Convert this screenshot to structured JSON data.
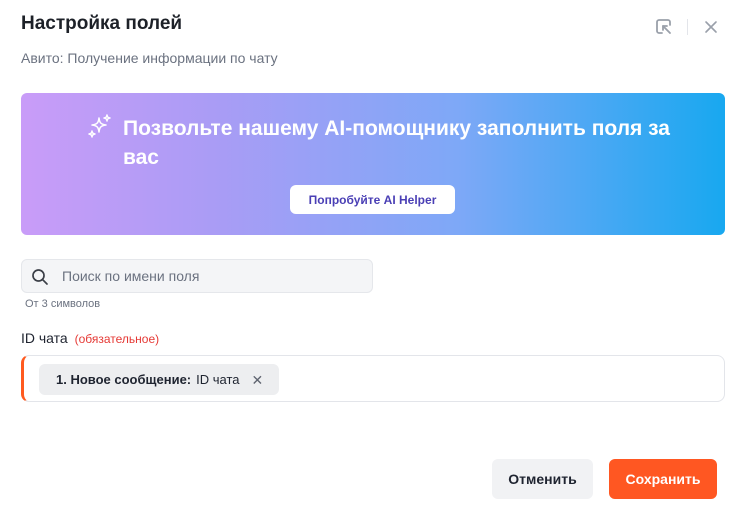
{
  "dialog": {
    "title": "Настройка полей",
    "subtitle": "Авито: Получение информации по чату"
  },
  "banner": {
    "text": "Позвольте нашему AI-помощнику заполнить поля за вас",
    "button_label": "Попробуйте AI Helper",
    "colors": {
      "start": "#c99cf8",
      "end": "#18a8f0"
    }
  },
  "search": {
    "placeholder": "Поиск по имени поля",
    "value": "",
    "hint": "От 3 символов"
  },
  "field": {
    "label": "ID чата",
    "required_text": "(обязательное)",
    "chip": {
      "source": "1. Новое сообщение:",
      "value": "ID чата"
    }
  },
  "footer": {
    "cancel_label": "Отменить",
    "save_label": "Сохранить"
  },
  "colors": {
    "accent": "#ff5722",
    "required": "#e53935"
  },
  "icons": {
    "header_left": "open-in-window-icon",
    "header_right": "close-icon",
    "banner": "sparkle-icon",
    "search": "search-icon",
    "chip_remove": "close-icon"
  }
}
